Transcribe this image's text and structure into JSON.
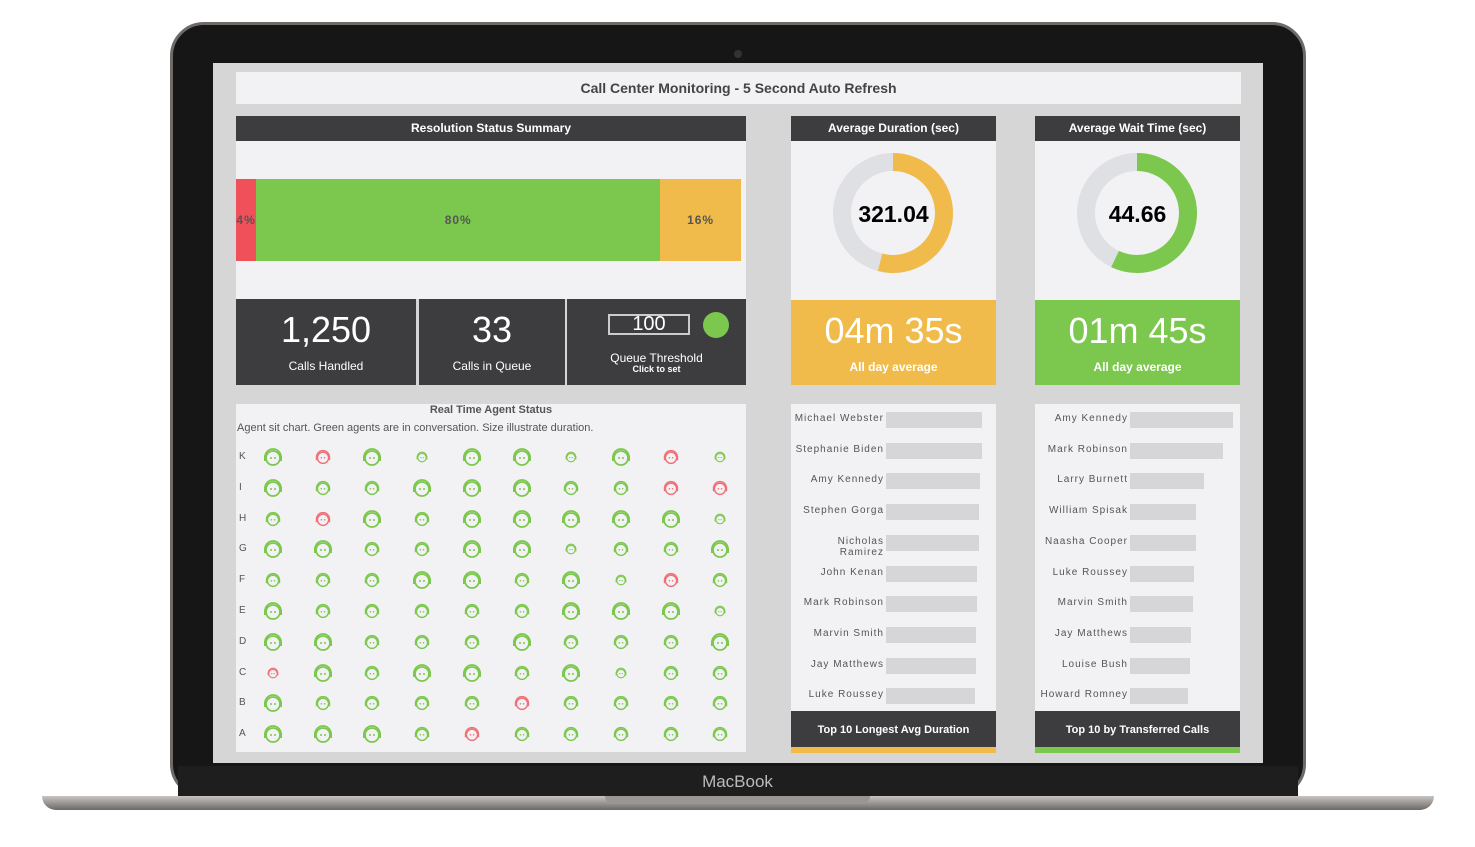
{
  "device_brand": "MacBook",
  "title": "Call Center Monitoring - 5 Second Auto Refresh",
  "resolution": {
    "title": "Resolution Status Summary",
    "segments": [
      {
        "label": "4%",
        "value": 4,
        "color": "#f0505a"
      },
      {
        "label": "80%",
        "value": 80,
        "color": "#7cc84e"
      },
      {
        "label": "16%",
        "value": 16,
        "color": "#f0bb4a"
      }
    ]
  },
  "stats": {
    "calls_handled": "1,250",
    "calls_handled_label": "Calls Handled",
    "calls_in_queue": "33",
    "calls_in_queue_label": "Calls in Queue",
    "threshold_value": "100",
    "threshold_label": "Queue Threshold",
    "threshold_hint": "Click to set",
    "threshold_status_color": "#7cc84e"
  },
  "avg_duration": {
    "title": "Average Duration (sec)",
    "value": "321.04",
    "fraction": 0.54,
    "color": "#f0bb4a",
    "display": "04m 35s",
    "sub": "All day average"
  },
  "avg_wait": {
    "title": "Average Wait Time (sec)",
    "value": "44.66",
    "fraction": 0.57,
    "color": "#7cc84e",
    "display": "01m 45s",
    "sub": "All day average"
  },
  "agents": {
    "title": "Real Time Agent Status",
    "subtitle": "Agent sit chart. Green agents are in conversation. Size illustrate duration.",
    "rows": [
      {
        "label": "K",
        "cells": [
          "g3",
          "r2",
          "g3",
          "g1",
          "g3",
          "g3",
          "g1",
          "g3",
          "r2",
          "g1"
        ]
      },
      {
        "label": "I",
        "cells": [
          "g3",
          "g2",
          "g2",
          "g3",
          "g3",
          "g3",
          "g2",
          "g2",
          "r2",
          "r2"
        ]
      },
      {
        "label": "H",
        "cells": [
          "g2",
          "r2",
          "g3",
          "g2",
          "g3",
          "g3",
          "g3",
          "g3",
          "g3",
          "g1"
        ]
      },
      {
        "label": "G",
        "cells": [
          "g3",
          "g3",
          "g2",
          "g2",
          "g3",
          "g3",
          "g1",
          "g2",
          "g2",
          "g3"
        ]
      },
      {
        "label": "F",
        "cells": [
          "g2",
          "g2",
          "g2",
          "g3",
          "g3",
          "g2",
          "g3",
          "g1",
          "r2",
          "g2"
        ]
      },
      {
        "label": "E",
        "cells": [
          "g3",
          "g2",
          "g2",
          "g2",
          "g2",
          "g2",
          "g3",
          "g3",
          "g3",
          "g1"
        ]
      },
      {
        "label": "D",
        "cells": [
          "g3",
          "g3",
          "g2",
          "g2",
          "g2",
          "g3",
          "g2",
          "g2",
          "g2",
          "g3"
        ]
      },
      {
        "label": "C",
        "cells": [
          "r1",
          "g3",
          "g2",
          "g3",
          "g3",
          "g2",
          "g3",
          "g1",
          "g2",
          "g2"
        ]
      },
      {
        "label": "B",
        "cells": [
          "g3",
          "g2",
          "g2",
          "g2",
          "g2",
          "r2",
          "g2",
          "g2",
          "g2",
          "g2"
        ]
      },
      {
        "label": "A",
        "cells": [
          "g3",
          "g3",
          "g3",
          "g2",
          "r2",
          "g2",
          "g2",
          "g2",
          "g2",
          "g2"
        ]
      }
    ]
  },
  "chart_data": [
    {
      "type": "bar",
      "orientation": "horizontal",
      "title": "Top 10 Longest Avg Duration",
      "accent": "#f0bb4a",
      "categories": [
        "Michael Webster",
        "Stephanie Biden",
        "Amy Kennedy",
        "Stephen Gorga",
        "Nicholas Ramirez",
        "John Kenan",
        "Mark Robinson",
        "Marvin Smith",
        "Jay Matthews",
        "Luke Roussey"
      ],
      "values": [
        96,
        96,
        94,
        93,
        93,
        91,
        91,
        90,
        90,
        89
      ]
    },
    {
      "type": "bar",
      "orientation": "horizontal",
      "title": "Top 10 by Transferred Calls",
      "accent": "#7cc84e",
      "categories": [
        "Amy Kennedy",
        "Mark Robinson",
        "Larry Burnett",
        "William Spisak",
        "Naasha Cooper",
        "Luke Roussey",
        "Marvin Smith",
        "Jay Matthews",
        "Louise Bush",
        "Howard Romney"
      ],
      "values": [
        103,
        93,
        74,
        66,
        66,
        64,
        63,
        61,
        60,
        58
      ]
    }
  ]
}
